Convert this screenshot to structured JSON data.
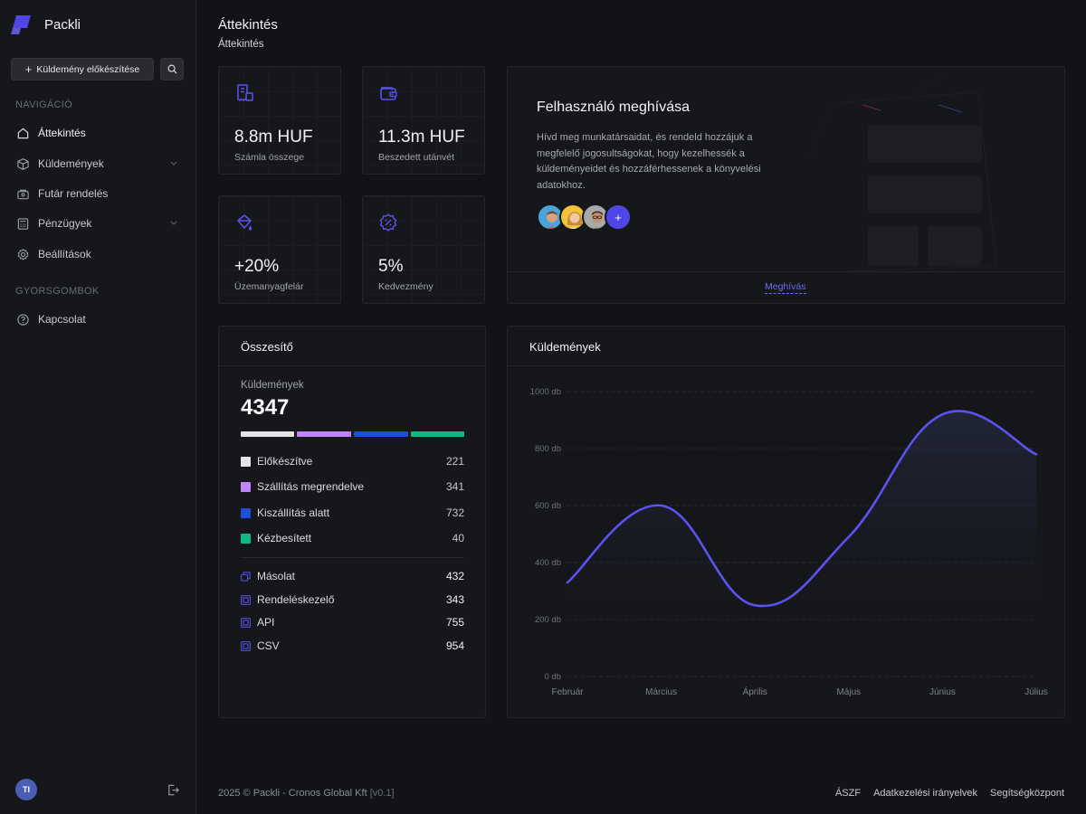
{
  "app": {
    "name": "Packli",
    "brand_color": "#4f46e5"
  },
  "sidebar": {
    "new_shipment_label": "Küldemény előkészítése",
    "nav_section_label": "NAVIGÁCIÓ",
    "items": [
      {
        "label": "Áttekintés",
        "icon": "home-icon",
        "active": true
      },
      {
        "label": "Küldemények",
        "icon": "box-icon",
        "has_submenu": true
      },
      {
        "label": "Futár rendelés",
        "icon": "courier-icon"
      },
      {
        "label": "Pénzügyek",
        "icon": "calculator-icon",
        "has_submenu": true
      },
      {
        "label": "Beállítások",
        "icon": "gear-icon"
      }
    ],
    "quick_section_label": "GYORSGOMBOK",
    "quick_items": [
      {
        "label": "Kapcsolat",
        "icon": "help-icon"
      }
    ],
    "user_initials": "TI"
  },
  "header": {
    "title": "Áttekintés",
    "breadcrumb": "Áttekintés"
  },
  "stats": [
    {
      "value": "8.8m HUF",
      "label": "Számla összege",
      "icon": "invoice-icon"
    },
    {
      "value": "11.3m HUF",
      "label": "Beszedett utánvét",
      "icon": "wallet-icon"
    },
    {
      "value": "+20%",
      "label": "Üzemanyagfelár",
      "icon": "fuel-icon"
    },
    {
      "value": "5%",
      "label": "Kedvezmény",
      "icon": "discount-icon"
    }
  ],
  "invite": {
    "title": "Felhasználó meghívása",
    "description": "Hívd meg munkatársaidat, és rendeld hozzájuk a megfelelő jogosultságokat, hogy kezelhessék a küldeményeidet és hozzáférhessenek a könyvelési adatokhoz.",
    "add_label": "+",
    "link_label": "Meghívás"
  },
  "summary": {
    "title": "Összesítő",
    "total_label": "Küldemények",
    "total": "4347",
    "statuses": [
      {
        "label": "Előkészítve",
        "value": "221",
        "color": "#e4e4e7"
      },
      {
        "label": "Szállítás megrendelve",
        "value": "341",
        "color": "#c084fc"
      },
      {
        "label": "Kiszállítás alatt",
        "value": "732",
        "color": "#1d4ed8"
      },
      {
        "label": "Kézbesített",
        "value": "40",
        "color": "#10b981"
      }
    ],
    "sources": [
      {
        "label": "Másolat",
        "value": "432",
        "icon": "copy-icon"
      },
      {
        "label": "Rendeléskezelő",
        "value": "343",
        "icon": "frame-icon"
      },
      {
        "label": "API",
        "value": "755",
        "icon": "frame-icon"
      },
      {
        "label": "CSV",
        "value": "954",
        "icon": "frame-icon"
      }
    ]
  },
  "shipments_chart": {
    "title": "Küldemények"
  },
  "chart_data": {
    "type": "line",
    "title": "Küldemények",
    "categories": [
      "Február",
      "Március",
      "Április",
      "Május",
      "Június",
      "Július"
    ],
    "series": [
      {
        "values": [
          330,
          600,
          250,
          490,
          920,
          780
        ]
      }
    ],
    "y_ticks": [
      "0 db",
      "200 db",
      "400 db",
      "600 db",
      "800 db",
      "1000 db"
    ],
    "ylim": [
      0,
      1000
    ],
    "line_color": "#5b52f0",
    "grid": true
  },
  "footer": {
    "copyright": "2025 ©  Packli - Cronos Global Kft",
    "version": "[v0.1]",
    "links": [
      "ÁSZF",
      "Adatkezelési irányelvek",
      "Segítségközpont"
    ]
  }
}
